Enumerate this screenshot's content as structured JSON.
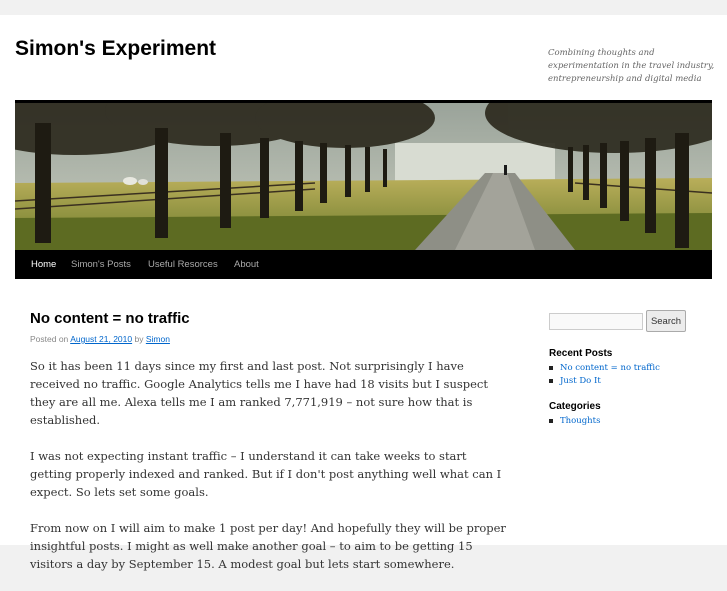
{
  "site": {
    "title": "Simon's Experiment",
    "description": "Combining thoughts and experimentation in the travel industry, entrepreneurship and digital media"
  },
  "nav": {
    "items": [
      {
        "label": "Home",
        "current": true
      },
      {
        "label": "Simon's Posts",
        "current": false
      },
      {
        "label": "Useful Resorces",
        "current": false
      },
      {
        "label": "About",
        "current": false
      }
    ]
  },
  "post": {
    "title": "No content = no traffic",
    "meta_prefix": "Posted on",
    "date": "August 21, 2010",
    "meta_by": "by",
    "author": "Simon",
    "paragraphs": [
      "So it has been 11 days since my first and last post. Not surprisingly I have received no traffic. Google Analytics tells me I have had 18 visits but I suspect they are all me. Alexa tells me I am ranked 7,771,919 – not sure how that is established.",
      "I was not expecting instant traffic – I understand it can take weeks to start getting properly indexed and ranked. But if I don't post anything well what can I expect. So lets set some goals.",
      "From now on I will aim to make 1 post per day! And hopefully they will be proper insightful posts. I might as well make another goal – to aim to be getting 15 visitors a day by September 15. A modest goal but lets start somewhere."
    ]
  },
  "sidebar": {
    "search": {
      "value": "",
      "button_label": "Search"
    },
    "recent_posts": {
      "title": "Recent Posts",
      "items": [
        "No content = no traffic",
        "Just Do It"
      ]
    },
    "categories": {
      "title": "Categories",
      "items": [
        "Thoughts"
      ]
    }
  },
  "colors": {
    "link": "#0066cc",
    "nav_background": "#000000",
    "page_background": "#f1f1f1"
  }
}
